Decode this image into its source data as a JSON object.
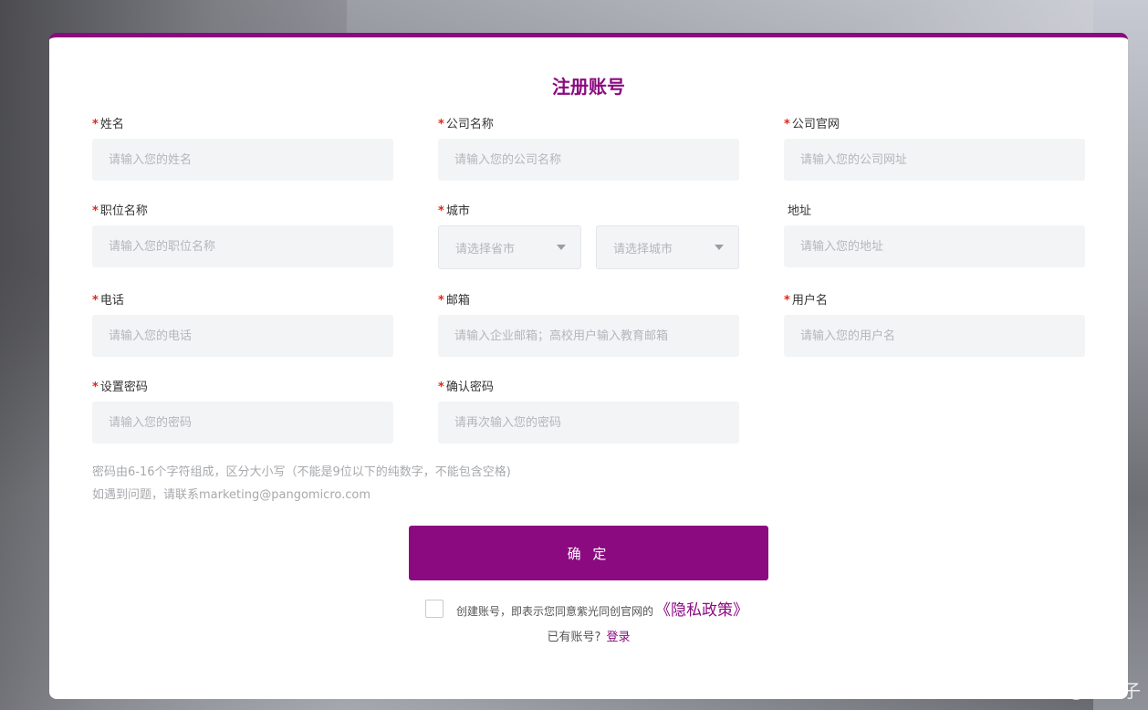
{
  "form": {
    "title": "注册账号",
    "required_mark": "*",
    "fields": {
      "name": {
        "label": "姓名",
        "placeholder": "请输入您的姓名"
      },
      "company": {
        "label": "公司名称",
        "placeholder": "请输入您的公司名称"
      },
      "website": {
        "label": "公司官网",
        "placeholder": "请输入您的公司网址"
      },
      "position": {
        "label": "职位名称",
        "placeholder": "请输入您的职位名称"
      },
      "city": {
        "label": "城市",
        "province_placeholder": "请选择省市",
        "city_placeholder": "请选择城市"
      },
      "address": {
        "label": "地址",
        "placeholder": "请输入您的地址"
      },
      "phone": {
        "label": "电话",
        "placeholder": "请输入您的电话"
      },
      "email": {
        "label": "邮箱",
        "placeholder": "请输入企业邮箱；高校用户输入教育邮箱"
      },
      "username": {
        "label": "用户名",
        "placeholder": "请输入您的用户名"
      },
      "password": {
        "label": "设置密码",
        "placeholder": "请输入您的密码"
      },
      "confirm_password": {
        "label": "确认密码",
        "placeholder": "请再次输入您的密码"
      }
    },
    "password_hint": "密码由6-16个字符组成，区分大小写（不能是9位以下的纯数字，不能包含空格)",
    "contact_hint": "如遇到问题，请联系marketing@pangomicro.com",
    "submit_label": "确 定",
    "agreement_text": "创建账号，即表示您同意紫光同创官网的",
    "policy_link": "《隐私政策》",
    "have_account_text": "已有账号?",
    "login_link": "登录"
  },
  "watermark": "CSDN @桦林子",
  "colors": {
    "accent": "#8b0a80",
    "required": "#e1251b"
  }
}
